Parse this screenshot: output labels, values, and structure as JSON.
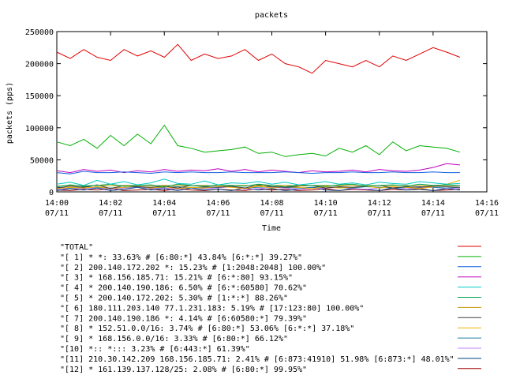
{
  "chart_data": {
    "type": "line",
    "title": "packets",
    "xlabel": "Time",
    "ylabel": "packets (pps)",
    "ylim": [
      0,
      250000
    ],
    "yticks": [
      0,
      50000,
      100000,
      150000,
      200000,
      250000
    ],
    "ytick_labels": [
      "0",
      "50000",
      "100000",
      "150000",
      "200000",
      "250000"
    ],
    "xlim": [
      "14:00",
      "14:16"
    ],
    "xticks": [
      "14:00",
      "14:02",
      "14:04",
      "14:06",
      "14:08",
      "14:10",
      "14:12",
      "14:14",
      "14:16"
    ],
    "xtick_labels": [
      {
        "time": "14:00",
        "date": "07/11"
      },
      {
        "time": "14:02",
        "date": "07/11"
      },
      {
        "time": "14:04",
        "date": "07/11"
      },
      {
        "time": "14:06",
        "date": "07/11"
      },
      {
        "time": "14:08",
        "date": "07/11"
      },
      {
        "time": "14:10",
        "date": "07/11"
      },
      {
        "time": "14:12",
        "date": "07/11"
      },
      {
        "time": "14:14",
        "date": "07/11"
      },
      {
        "time": "14:16",
        "date": "07/11"
      }
    ],
    "grid": false,
    "legend_position": "below",
    "x": [
      "14:00",
      "14:00:30",
      "14:01",
      "14:01:30",
      "14:02",
      "14:02:30",
      "14:03",
      "14:03:30",
      "14:04",
      "14:04:30",
      "14:05",
      "14:05:30",
      "14:06",
      "14:06:30",
      "14:07",
      "14:07:30",
      "14:08",
      "14:08:30",
      "14:09",
      "14:09:30",
      "14:10",
      "14:10:30",
      "14:11",
      "14:11:30",
      "14:12",
      "14:12:30",
      "14:13",
      "14:13:30",
      "14:14",
      "14:14:30",
      "14:15"
    ],
    "series": [
      {
        "name": "\"TOTAL\"",
        "color": "#e00000",
        "values": [
          218000,
          208000,
          222000,
          210000,
          205000,
          222000,
          212000,
          220000,
          210000,
          230000,
          205000,
          215000,
          208000,
          212000,
          222000,
          205000,
          215000,
          200000,
          195000,
          185000,
          205000,
          200000,
          195000,
          205000,
          195000,
          212000,
          205000,
          215000,
          225000,
          218000,
          210000
        ]
      },
      {
        "name": "\"[ 1] * *: 33.63% # [6:80:*] 43.84% [6:*:*] 39.27%\"",
        "color": "#00b000",
        "values": [
          78000,
          72000,
          82000,
          68000,
          88000,
          72000,
          90000,
          75000,
          104000,
          72000,
          68000,
          62000,
          64000,
          66000,
          70000,
          60000,
          62000,
          55000,
          58000,
          60000,
          56000,
          68000,
          62000,
          72000,
          58000,
          78000,
          64000,
          72000,
          70000,
          68000,
          62000
        ]
      },
      {
        "name": "\"[ 2] 200.140.172.202 *: 15.23% # [1:2048:2048] 100.00%\"",
        "color": "#1060e0",
        "values": [
          30000,
          28000,
          32000,
          30000,
          30000,
          31000,
          30000,
          29000,
          31000,
          30000,
          31000,
          30000,
          30000,
          31000,
          30000,
          30000,
          30000,
          31000,
          30000,
          29000,
          30000,
          30000,
          31000,
          30000,
          30000,
          31000,
          30000,
          30000,
          31000,
          30000,
          30000
        ]
      },
      {
        "name": "\"[ 3] * 168.156.185.71: 15.21% # [6:*:80] 93.15%\"",
        "color": "#c000c0",
        "values": [
          33000,
          30000,
          35000,
          32000,
          34000,
          30000,
          33000,
          31000,
          35000,
          32000,
          34000,
          33000,
          36000,
          32000,
          35000,
          31000,
          34000,
          32000,
          30000,
          33000,
          31000,
          32000,
          34000,
          31000,
          35000,
          33000,
          32000,
          34000,
          38000,
          44000,
          42000
        ]
      },
      {
        "name": "\"[ 4] * 200.140.190.186: 6.50% # [6:*:60580] 70.62%\"",
        "color": "#00c8c8",
        "values": [
          12000,
          15000,
          10000,
          18000,
          12000,
          16000,
          11000,
          14000,
          20000,
          13000,
          12000,
          17000,
          11000,
          14000,
          13000,
          16000,
          12000,
          15000,
          11000,
          13000,
          16000,
          12000,
          14000,
          11000,
          15000,
          13000,
          12000,
          16000,
          14000,
          12000,
          13000
        ]
      },
      {
        "name": "\"[ 5] * 200.140.172.202: 5.30% # [1:*:*] 88.26%\"",
        "color": "#00a050",
        "values": [
          8000,
          11000,
          9000,
          10000,
          12000,
          9000,
          10000,
          11000,
          8000,
          12000,
          10000,
          9000,
          11000,
          10000,
          9000,
          12000,
          10000,
          8000,
          11000,
          10000,
          9000,
          11000,
          12000,
          9000,
          10000,
          11000,
          9000,
          12000,
          10000,
          11000,
          10000
        ]
      },
      {
        "name": "\"[ 6] 180.111.203.140 77.1.231.183: 5.19% # [17:123:80] 100.00%\"",
        "color": "#c89600",
        "values": [
          9000,
          10000,
          9500,
          10000,
          9500,
          10000,
          10000,
          9500,
          10000,
          9500,
          10000,
          10000,
          9500,
          10000,
          10000,
          9500,
          10000,
          10000,
          9500,
          10000,
          10000,
          9500,
          10000,
          10000,
          9500,
          10000,
          10000,
          9500,
          10000,
          10000,
          9500
        ]
      },
      {
        "name": "\"[ 7] 200.140.190.186 *: 4.14% # [6:60580:*] 79.39%\"",
        "color": "#404040",
        "values": [
          6000,
          9000,
          7000,
          11000,
          5000,
          10000,
          8000,
          7000,
          9000,
          6000,
          10000,
          8000,
          7000,
          9000,
          6000,
          11000,
          8000,
          7000,
          9000,
          10000,
          6000,
          8000,
          7000,
          9000,
          10000,
          6000,
          8000,
          7000,
          9000,
          8000,
          7000
        ]
      },
      {
        "name": "\"[ 8] * 152.51.0.0/16: 3.74% # [6:80:*] 53.06% [6:*:*] 37.18%\"",
        "color": "#f0b000",
        "values": [
          5000,
          7000,
          6000,
          8000,
          5000,
          7000,
          9000,
          6000,
          8000,
          5000,
          7000,
          6000,
          8000,
          7000,
          5000,
          9000,
          6000,
          8000,
          7000,
          5000,
          8000,
          6000,
          7000,
          9000,
          6000,
          8000,
          7000,
          5000,
          8000,
          12000,
          18000
        ]
      },
      {
        "name": "\"[ 9] * 168.156.0.0/16: 3.33% # [6:80:*] 66.12%\"",
        "color": "#2080a0",
        "values": [
          7000,
          6000,
          8000,
          7000,
          6000,
          7000,
          8000,
          6000,
          7000,
          8000,
          6000,
          7000,
          7000,
          8000,
          6000,
          7000,
          8000,
          7000,
          6000,
          7000,
          8000,
          7000,
          6000,
          8000,
          7000,
          6000,
          7000,
          8000,
          7000,
          6000,
          7000
        ]
      },
      {
        "name": "\"[10] *:: *::: 3.23% # [6:443:*] 61.39%\"",
        "color": "#c080ff",
        "values": [
          4000,
          6000,
          5000,
          7000,
          4000,
          6000,
          8000,
          5000,
          6000,
          4000,
          7000,
          5000,
          6000,
          8000,
          4000,
          5000,
          7000,
          6000,
          4000,
          5000,
          6000,
          7000,
          5000,
          4000,
          6000,
          8000,
          5000,
          6000,
          7000,
          5000,
          6000
        ]
      },
      {
        "name": "\"[11] 210.30.142.209 168.156.185.71: 2.41% # [6:873:41910] 51.98% [6:873:*] 48.01%\"",
        "color": "#004080",
        "values": [
          2000,
          5000,
          3000,
          6000,
          2000,
          4000,
          7000,
          3000,
          5000,
          2000,
          6000,
          3000,
          4000,
          2000,
          6000,
          3000,
          5000,
          2000,
          4000,
          7000,
          3000,
          2000,
          5000,
          4000,
          2000,
          6000,
          3000,
          4000,
          2000,
          5000,
          3000
        ]
      },
      {
        "name": "\"[12] * 161.139.137.128/25: 2.08% # [6:80:*] 99.95%\"",
        "color": "#a00000",
        "values": [
          3000,
          2000,
          4000,
          3000,
          5000,
          2000,
          3000,
          4000,
          2000,
          5000,
          3000,
          2000,
          4000,
          3000,
          2000,
          5000,
          3000,
          4000,
          2000,
          3000,
          5000,
          2000,
          4000,
          3000,
          2000,
          4000,
          3000,
          5000,
          2000,
          3000,
          4000
        ]
      }
    ]
  }
}
